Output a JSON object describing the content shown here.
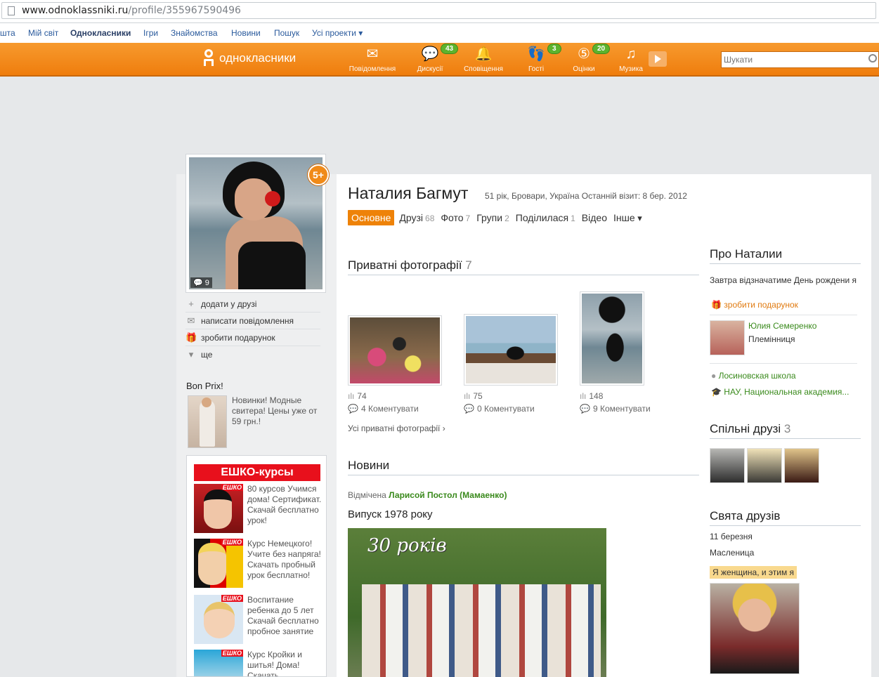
{
  "browser": {
    "url_host": "www.odnoklassniki.ru",
    "url_path": "/profile/355967590496"
  },
  "toplinks": [
    "шта",
    "Мій світ",
    "Однокласники",
    "Ігри",
    "Знайомства",
    "Новини",
    "Пошук",
    "Усі проекти ▾"
  ],
  "header": {
    "logo": "однокласники",
    "nav": [
      {
        "label": "Повідомлення",
        "icon": "envelope-icon",
        "badge": ""
      },
      {
        "label": "Дискусії",
        "icon": "discussions-icon",
        "badge": "43"
      },
      {
        "label": "Сповіщення",
        "icon": "bell-icon",
        "badge": ""
      },
      {
        "label": "Гості",
        "icon": "footprints-icon",
        "badge": "3"
      },
      {
        "label": "Оцінки",
        "icon": "ratings-icon",
        "badge": "20"
      },
      {
        "label": "Музика",
        "icon": "music-note-icon",
        "badge": ""
      }
    ],
    "search_placeholder": "Шукати"
  },
  "profile": {
    "name": "Наталия Багмут",
    "meta": "51 рік, Бровари, Україна  Останній візит: 8 бер. 2012",
    "avatar_comments": "9",
    "badge": "5+",
    "actions": [
      "додати у друзі",
      "написати повідомлення",
      "зробити подарунок",
      "ще"
    ],
    "tabs": [
      {
        "label": "Основне",
        "count": ""
      },
      {
        "label": "Друзі",
        "count": "68"
      },
      {
        "label": "Фото",
        "count": "7"
      },
      {
        "label": "Групи",
        "count": "2"
      },
      {
        "label": "Поділилася",
        "count": "1"
      },
      {
        "label": "Відео",
        "count": ""
      },
      {
        "label": "Інше",
        "count": ""
      }
    ]
  },
  "left_ads": {
    "bonprix_title": "Bon Prix!",
    "bonprix_text": "Новинки! Модные свитера! Цены уже от 59 грн.!",
    "eshko_title": "ЕШКО-курсы",
    "eshko_tag": "ЕШКО",
    "items": [
      "80 курсов Учимся дома! Сертификат. Скачай бесплатно урок!",
      "Курс Немецкого! Учите без напряга! Скачать пробный урок бесплатно!",
      "Воспитание ребенка до 5 лет Скачай бесплатно пробное занятие",
      "Курс Кройки и шитья! Дома! Скачать"
    ]
  },
  "private_photos": {
    "title": "Приватні фотографії",
    "count": "7",
    "items": [
      {
        "views": "74",
        "comments": "4 Коментувати"
      },
      {
        "views": "75",
        "comments": "0 Коментувати"
      },
      {
        "views": "148",
        "comments": "9 Коментувати"
      }
    ],
    "all_link": "Усі приватні фотографії ›"
  },
  "news": {
    "title": "Новини",
    "tagged_prefix": "Відмічена",
    "tagged_by": "Ларисой Постол (Мамаенко)",
    "text": "Випуск 1978 року",
    "photo_caption": "30 років"
  },
  "about": {
    "title": "Про Наталии",
    "birthday": "Завтра відзначатиме День рождени я",
    "gift_link": "зробити подарунок",
    "relative_name": "Юлия Семеренко",
    "relative_role": "Племінниця",
    "school": "Лосиновская школа",
    "university": "НАУ, Национальная академия..."
  },
  "mutual_friends": {
    "title": "Спільні друзі",
    "count": "3"
  },
  "holidays": {
    "title": "Свята друзів",
    "date": "11 березня",
    "holiday": "Масленица",
    "tag": "Я женщина, и этим я"
  }
}
